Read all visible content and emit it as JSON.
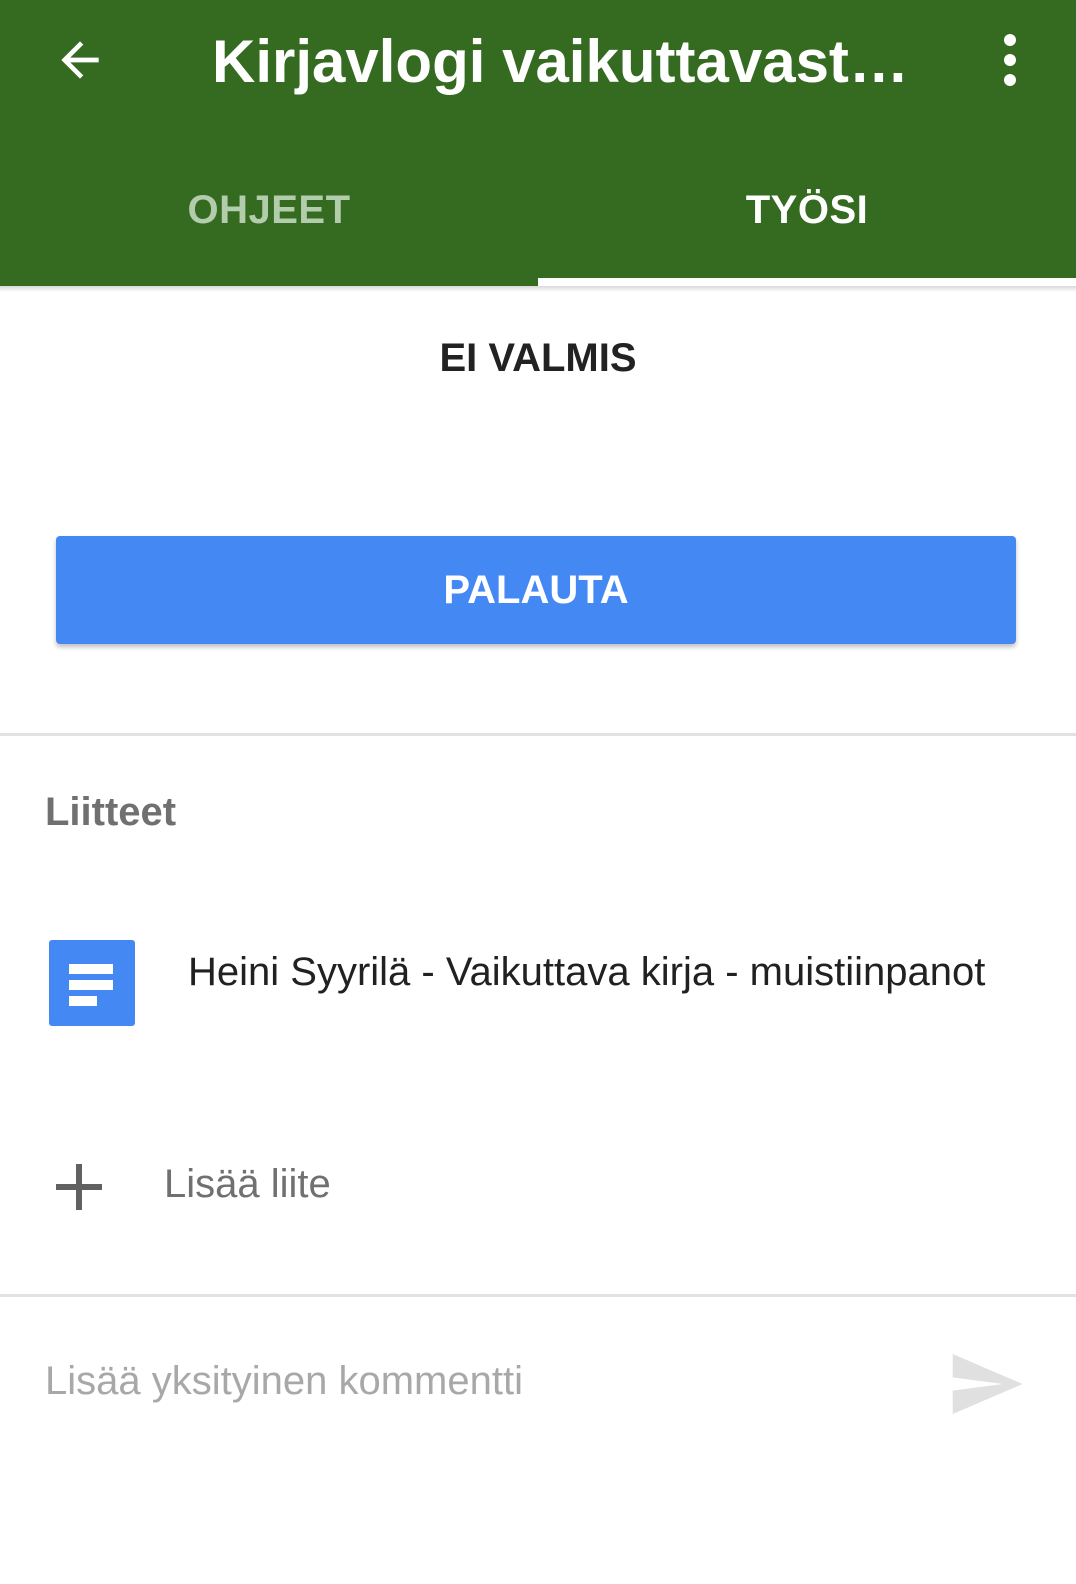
{
  "header": {
    "title": "Kirjavlogi vaikuttavasta kirjasta",
    "back_icon": "arrow-back-icon",
    "menu_icon": "more-vert-icon",
    "background_color": "#356b21"
  },
  "tabs": [
    {
      "label": "OHJEET",
      "active": false
    },
    {
      "label": "TYÖSI",
      "active": true
    }
  ],
  "status": {
    "text": "EI VALMIS"
  },
  "submit_button": {
    "label": "PALAUTA",
    "color": "#4488f4"
  },
  "attachments": {
    "title": "Liitteet",
    "items": [
      {
        "icon": "google-docs-icon",
        "name": "Heini Syyrilä - Vaikuttava kirja - muistiinpanot"
      }
    ],
    "add_label": "Lisää liite",
    "add_icon": "plus-icon"
  },
  "comment": {
    "placeholder": "Lisää yksityinen kommentti",
    "value": "",
    "send_icon": "send-icon"
  }
}
